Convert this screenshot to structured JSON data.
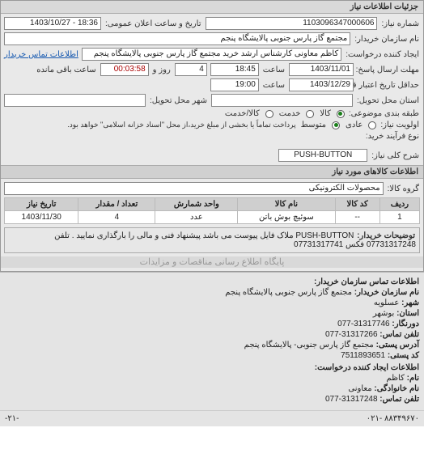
{
  "panel_title": "جزئیات اطلاعات نیاز",
  "top": {
    "req_no_label": "شماره نیاز:",
    "req_no": "1103096347000606",
    "announce_label": "تاریخ و ساعت اعلان عمومی:",
    "announce": "18:36 - 1403/10/27",
    "buyer_name_label": "نام سازمان خریدار:",
    "buyer_name": "مجتمع گاز پارس جنوبی  پالایشگاه پنجم",
    "creator_label": "ایجاد کننده درخواست:",
    "creator": "کاظم معاونی کارشناس ارشد خرید مجتمع گاز پارس جنوبی  پالایشگاه پنجم",
    "buyer_contact_link": "اطلاعات تماس خریدار"
  },
  "deadlines": {
    "until_label": "مهلت ارسال پاسخ: تا تاریخ:",
    "until_date": "1403/11/01",
    "hour_label": "ساعت",
    "until_time": "18:45",
    "days": "4",
    "days_label": "روز و",
    "countdown": "00:03:58",
    "remain_label": "ساعت باقی مانده",
    "validity_label": "حداقل تاریخ اعتبار قیمت: تا تاریخ:",
    "validity_date": "1403/12/29",
    "validity_time": "19:00"
  },
  "location": {
    "province_label": "استان محل تحویل:",
    "city_label": "شهر محل تحویل:"
  },
  "classification": {
    "label": "طبقه بندی موضوعی:",
    "opt_goods": "کالا",
    "opt_service": "خدمت",
    "opt_goods_service": "کالا/خدمت",
    "selected": "goods"
  },
  "priority": {
    "label": "اولویت نیاز:",
    "opt_normal": "عادی",
    "opt_med": "متوسط",
    "note": "پرداخت تماماً یا بخشی از مبلغ خرید،از محل \"اسناد خزانه اسلامی\" خواهد بود.",
    "selected": "med"
  },
  "process": {
    "label": "نوع فرآیند خرید:"
  },
  "summary": {
    "label": "شرح کلی نیاز:",
    "value": "PUSH-BUTTON"
  },
  "items_header": "اطلاعات کالاهای مورد نیاز",
  "group": {
    "label": "گروه کالا:",
    "value": "محصولات الکترونیکی"
  },
  "table": {
    "headers": [
      "ردیف",
      "کد کالا",
      "نام کالا",
      "واحد شمارش",
      "تعداد / مقدار",
      "تاریخ نیاز"
    ],
    "rows": [
      [
        "1",
        "--",
        "سوئیچ بوش باتن",
        "عدد",
        "4",
        "1403/11/30"
      ]
    ]
  },
  "buyer_note": {
    "label": "توضیحات خریدار:",
    "text": "PUSH-BUTTON ملاک فایل پیوست می باشد پیشنهاد فنی و مالی را بارگذاری نمایید . تلفن 07731317248 فکس 07731317741"
  },
  "watermark": "پایگاه اطلاع رسانی مناقصات و مزایدات",
  "contact": {
    "header": "اطلاعات تماس سازمان خریدار:",
    "name_k": "نام سازمان خریدار:",
    "name_v": "مجتمع گاز پارس جنوبی پالایشگاه پنجم",
    "city_k": "شهر:",
    "city_v": "عسلویه",
    "province_k": "استان:",
    "province_v": "بوشهر",
    "fax_k": "دورنگار:",
    "fax_v": "31317746-077",
    "tel_k": "تلفن تماس:",
    "tel_v": "31317266-077",
    "addr_k": "آدرس پستی:",
    "addr_v": "مجتمع گاز پارس جنوبی- پالایشگاه پنجم",
    "post_k": "کد پستی:",
    "post_v": "7511893651",
    "creator_header": "اطلاعات ایجاد کننده درخواست:",
    "fname_k": "نام:",
    "fname_v": "کاظم",
    "lname_k": "نام خانوادگی:",
    "lname_v": "معاونی",
    "ctel_k": "تلفن تماس:",
    "ctel_v": "31317248-077"
  },
  "footer": {
    "left": "-۲۱-",
    "right": "۸۸۳۴۹۶۷۰ -۰۲۱"
  }
}
